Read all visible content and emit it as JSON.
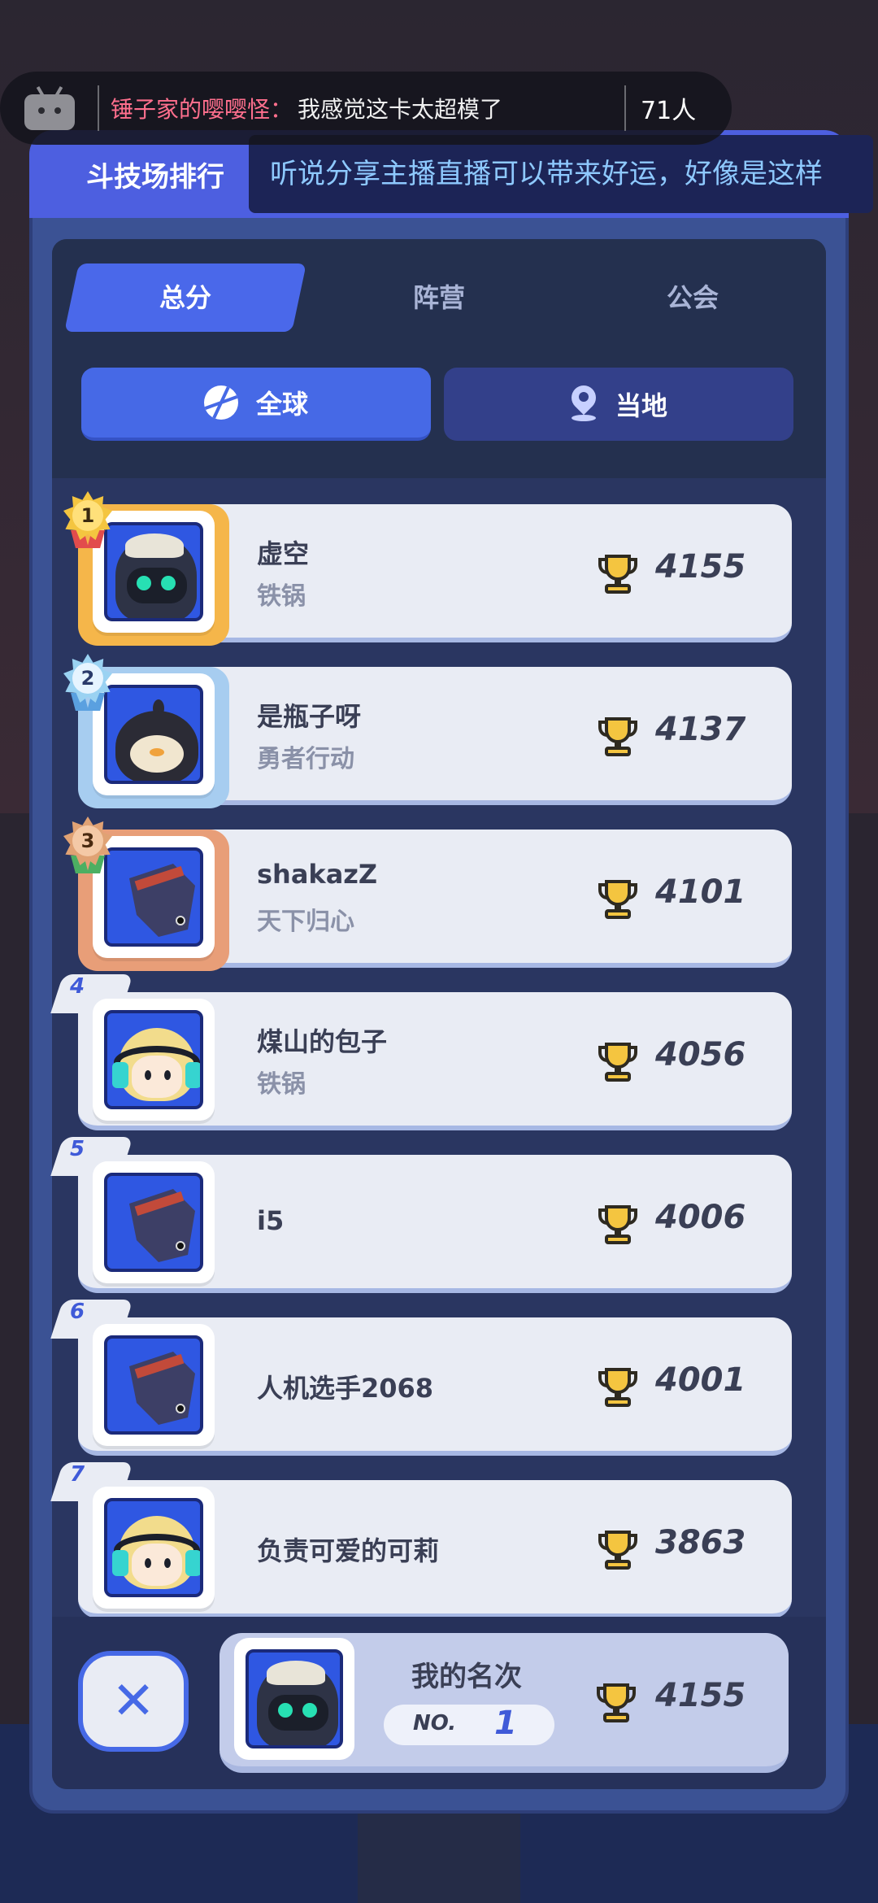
{
  "danmaku": {
    "user": "锤子家的嘤嘤怪：",
    "message": "我感觉这卡太超模了",
    "viewers": "71人"
  },
  "header": {
    "title": "斗技场排行",
    "broadcast": "听说分享主播直播可以带来好运，好像是这样"
  },
  "tabs": [
    {
      "label": "总分",
      "active": true
    },
    {
      "label": "阵营",
      "active": false
    },
    {
      "label": "公会",
      "active": false
    }
  ],
  "scope": {
    "global_label": "全球",
    "local_label": "当地",
    "selected": "全球"
  },
  "rankings": [
    {
      "rank": "1",
      "name": "虚空",
      "guild": "铁锅",
      "score": "4155",
      "avatar": "hooded-masked-character"
    },
    {
      "rank": "2",
      "name": "是瓶子呀",
      "guild": "勇者行动",
      "score": "4137",
      "avatar": "penguin-character"
    },
    {
      "rank": "3",
      "name": "shakazZ",
      "guild": "天下归心",
      "score": "4101",
      "avatar": "shark-fin-character"
    },
    {
      "rank": "4",
      "name": "煤山的包子",
      "guild": "铁锅",
      "score": "4056",
      "avatar": "headphone-girl-character"
    },
    {
      "rank": "5",
      "name": "i5",
      "guild": "",
      "score": "4006",
      "avatar": "shark-fin-character"
    },
    {
      "rank": "6",
      "name": "人机选手2068",
      "guild": "",
      "score": "4001",
      "avatar": "shark-fin-character"
    },
    {
      "rank": "7",
      "name": "负责可爱的可莉",
      "guild": "",
      "score": "3863",
      "avatar": "headphone-girl-character"
    }
  ],
  "my_rank": {
    "label": "我的名次",
    "no_label": "NO.",
    "rank": "1",
    "score": "4155",
    "avatar": "hooded-masked-character"
  },
  "close_icon": "close-icon",
  "colors": {
    "accent": "#4669e6",
    "panel": "#3b5294",
    "gold": "#f5b64a",
    "silver": "#a7cdf0",
    "bronze": "#e89e78",
    "broadcast_text": "#8ec9ff",
    "danmaku_user": "#ff6f8d"
  }
}
